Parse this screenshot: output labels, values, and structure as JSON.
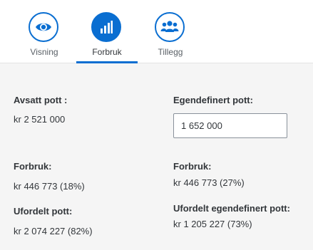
{
  "tabs": [
    {
      "label": "Visning",
      "icon": "eye-icon"
    },
    {
      "label": "Forbruk",
      "icon": "bar-chart-icon",
      "active": true
    },
    {
      "label": "Tillegg",
      "icon": "group-icon"
    }
  ],
  "left": {
    "avsatt_label": "Avsatt pott :",
    "avsatt_value": "kr 2 521 000",
    "forbruk_label": "Forbruk:",
    "forbruk_value": "kr 446 773 (18%)",
    "ufordelt_label": "Ufordelt pott:",
    "ufordelt_value": "kr 2 074 227 (82%)"
  },
  "right": {
    "egendefinert_label": "Egendefinert pott:",
    "egendefinert_value": "1 652 000",
    "forbruk_label": "Forbruk:",
    "forbruk_value": "kr 446 773 (27%)",
    "ufordelt_label": "Ufordelt egendefinert pott:",
    "ufordelt_value": "kr 1 205 227 (73%)"
  },
  "colors": {
    "accent": "#0a6ed1",
    "background": "#f5f5f5",
    "text": "#32363a"
  }
}
